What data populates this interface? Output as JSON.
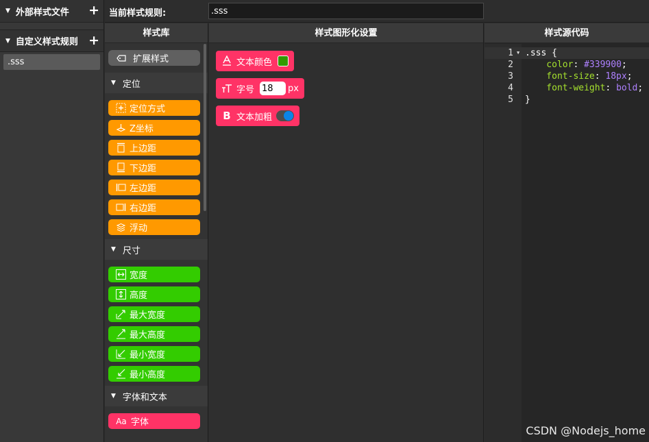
{
  "sidebar": {
    "external_title": "外部样式文件",
    "custom_title": "自定义样式规则",
    "files": [
      ".sss"
    ]
  },
  "topbar": {
    "label": "当前样式规则:",
    "rule_value": ".sss"
  },
  "library": {
    "title": "样式库",
    "extend_label": "扩展样式",
    "categories": [
      {
        "name": "定位",
        "color": "#ff9900",
        "items": [
          {
            "label": "定位方式",
            "icon": "position-icon"
          },
          {
            "label": "Z坐标",
            "icon": "z-index-icon"
          },
          {
            "label": "上边距",
            "icon": "top-edge-icon"
          },
          {
            "label": "下边距",
            "icon": "bottom-edge-icon"
          },
          {
            "label": "左边距",
            "icon": "left-edge-icon"
          },
          {
            "label": "右边距",
            "icon": "right-edge-icon"
          },
          {
            "label": "浮动",
            "icon": "float-icon"
          }
        ]
      },
      {
        "name": "尺寸",
        "color": "#33cc00",
        "items": [
          {
            "label": "宽度",
            "icon": "width-icon"
          },
          {
            "label": "高度",
            "icon": "height-icon"
          },
          {
            "label": "最大宽度",
            "icon": "max-width-icon"
          },
          {
            "label": "最大高度",
            "icon": "max-height-icon"
          },
          {
            "label": "最小宽度",
            "icon": "min-width-icon"
          },
          {
            "label": "最小高度",
            "icon": "min-height-icon"
          }
        ]
      },
      {
        "name": "字体和文本",
        "color": "#ff3366",
        "items": [
          {
            "label": "字体",
            "icon": "font-icon",
            "icon_text": "Aa"
          }
        ]
      }
    ]
  },
  "graph": {
    "title": "样式图形化设置",
    "color_label": "文本颜色",
    "color_value": "#339900",
    "size_label": "字号",
    "size_value": "18",
    "size_unit": "px",
    "bold_label": "文本加粗",
    "bold_on": true
  },
  "source": {
    "title": "样式源代码",
    "lines": [
      {
        "num": "1",
        "parts": [
          {
            "t": ".sss {",
            "c": "c-sel"
          }
        ]
      },
      {
        "num": "2",
        "parts": [
          {
            "t": "    color",
            "c": "c-prop"
          },
          {
            "t": ": ",
            "c": "c-pun"
          },
          {
            "t": "#339900",
            "c": "c-val"
          },
          {
            "t": ";",
            "c": "c-pun"
          }
        ]
      },
      {
        "num": "3",
        "parts": [
          {
            "t": "    font-size",
            "c": "c-prop"
          },
          {
            "t": ": ",
            "c": "c-pun"
          },
          {
            "t": "18px",
            "c": "c-val"
          },
          {
            "t": ";",
            "c": "c-pun"
          }
        ]
      },
      {
        "num": "4",
        "parts": [
          {
            "t": "    font-weight",
            "c": "c-prop"
          },
          {
            "t": ": ",
            "c": "c-pun"
          },
          {
            "t": "bold",
            "c": "c-val"
          },
          {
            "t": ";",
            "c": "c-pun"
          }
        ]
      },
      {
        "num": "5",
        "parts": [
          {
            "t": "}",
            "c": "c-sel"
          }
        ]
      }
    ]
  },
  "watermark": "CSDN @Nodejs_home"
}
